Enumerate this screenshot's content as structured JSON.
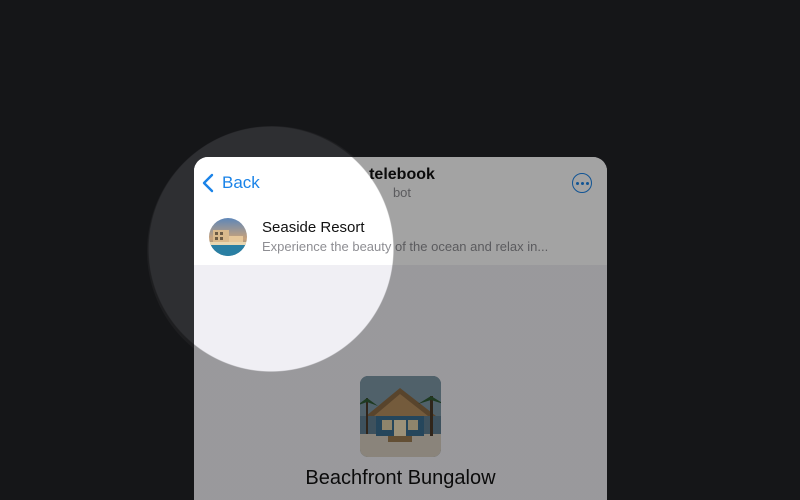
{
  "header": {
    "back_label": "Back",
    "title": "telebook",
    "subtitle": "bot"
  },
  "item": {
    "title": "Seaside Resort",
    "description": "Experience the beauty of the ocean and relax in..."
  },
  "product": {
    "title": "Beachfront Bungalow"
  },
  "colors": {
    "accent": "#1a83e8",
    "backdrop": "#212226"
  },
  "icons": {
    "back": "chevron-left-icon",
    "more": "ellipsis-circle-icon"
  }
}
